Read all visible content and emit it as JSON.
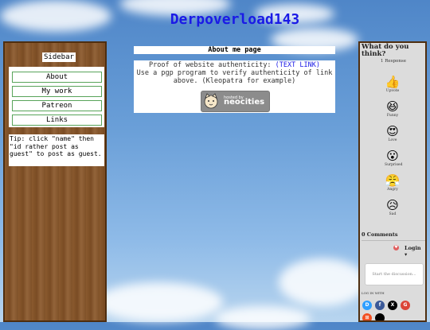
{
  "site": {
    "title": "Derpoverload143"
  },
  "sidebar": {
    "heading": "Sidebar",
    "links": [
      {
        "label": "About"
      },
      {
        "label": "My work"
      },
      {
        "label": "Patreon"
      },
      {
        "label": "Links"
      }
    ],
    "tip": "Tip: click \"name\" then \"id rather post as guest\" to post as guest."
  },
  "main": {
    "header": "About me page",
    "line1_prefix": "Proof of website authenticity: ",
    "line1_link": "(TEXT LINK)",
    "line2": "Use a pgp program to verify authenticity of link above. (Kleopatra for example)",
    "badge": {
      "hosted_by": "hosted by",
      "name": "neocities"
    }
  },
  "comments": {
    "title": "What do you think?",
    "responses": "1 Response",
    "reactions": [
      {
        "label": "Upvote",
        "icon": "thumbs-up-icon",
        "glyph": "👍"
      },
      {
        "label": "Funny",
        "icon": "laughing-face-icon",
        "glyph": "😆"
      },
      {
        "label": "Love",
        "icon": "heart-eyes-icon",
        "glyph": "😍"
      },
      {
        "label": "Surprised",
        "icon": "surprised-face-icon",
        "glyph": "😮"
      },
      {
        "label": "Angry",
        "icon": "angry-face-icon",
        "glyph": "😤"
      },
      {
        "label": "Sad",
        "icon": "sad-face-icon",
        "glyph": "😥"
      }
    ],
    "count_label": "0 Comments",
    "login_label": "Login ▾",
    "input_placeholder": "Start the discussion...",
    "login_with": "LOG IN WITH",
    "social": [
      {
        "name": "disqus-icon",
        "glyph": "D",
        "color": "#2e9fff"
      },
      {
        "name": "facebook-icon",
        "glyph": "f",
        "color": "#3b5998"
      },
      {
        "name": "x-icon",
        "glyph": "X",
        "color": "#000000"
      },
      {
        "name": "google-icon",
        "glyph": "G",
        "color": "#db4437"
      },
      {
        "name": "microsoft-icon",
        "glyph": "⊞",
        "color": "#f25022"
      },
      {
        "name": "apple-icon",
        "glyph": "",
        "color": "#000000"
      }
    ]
  }
}
